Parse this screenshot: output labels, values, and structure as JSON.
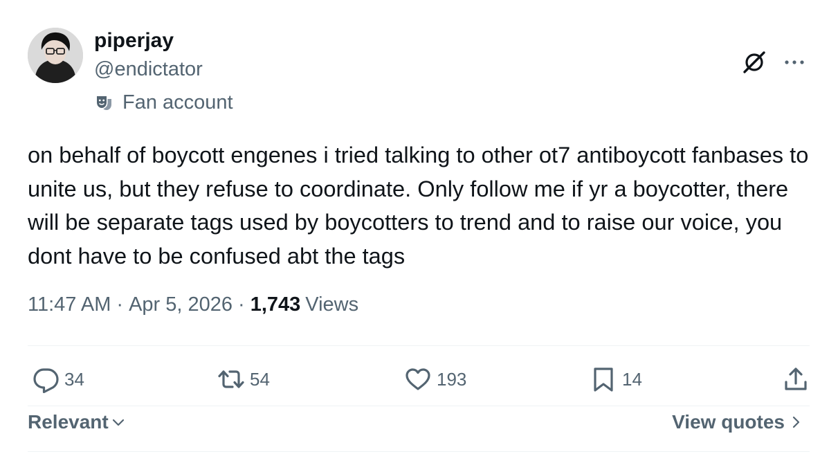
{
  "author": {
    "display_name": "piperjay",
    "handle": "@endictator",
    "label": "Fan account",
    "label_icon": "theater-masks-icon"
  },
  "tweet": {
    "text": "on behalf of boycott engenes i tried talking to other ot7 antiboycott fanbases to unite us, but they refuse to coordinate. Only follow me if yr a boycotter, there will be separate tags used by boycotters to trend and to raise our voice, you dont have to be confused abt the tags",
    "time": "11:47 AM",
    "separator": "·",
    "date": "Apr 5, 2026",
    "views_count": "1,743",
    "views_label": "Views"
  },
  "actions": {
    "replies": "34",
    "reposts": "54",
    "likes": "193",
    "bookmarks": "14"
  },
  "footer": {
    "sort_label": "Relevant",
    "quotes_label": "View quotes"
  },
  "colors": {
    "text_primary": "#0f1419",
    "text_secondary": "#536471",
    "divider": "#eff3f4"
  }
}
